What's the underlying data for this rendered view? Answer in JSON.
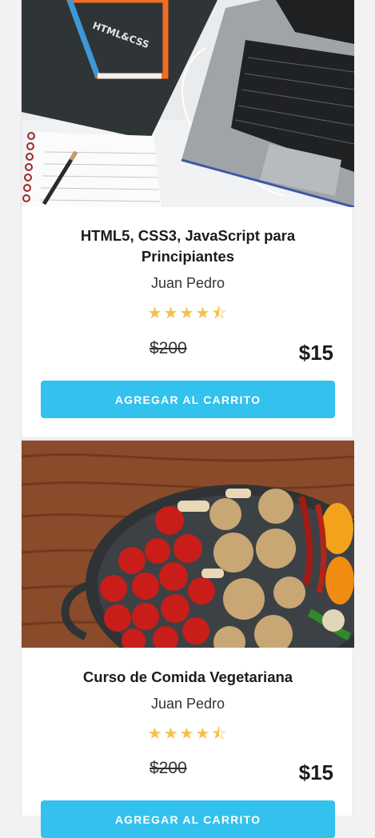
{
  "courses": [
    {
      "title": "HTML5, CSS3, JavaScript para Principiantes",
      "author": "Juan Pedro",
      "rating_stars": 4.5,
      "rating_display": "★★★★★",
      "old_price": "$200",
      "price": "$15",
      "button_label": "AGREGAR AL CARRITO",
      "book_cover_text": "HTML&CSS"
    },
    {
      "title": "Curso de Comida Vegetariana",
      "author": "Juan Pedro",
      "rating_stars": 4.5,
      "rating_display": "★★★★★",
      "old_price": "$200",
      "price": "$15",
      "button_label": "AGREGAR AL CARRITO"
    }
  ],
  "colors": {
    "accent": "#33c1ee",
    "star": "#f3c14a",
    "background": "#f3f1f2"
  }
}
